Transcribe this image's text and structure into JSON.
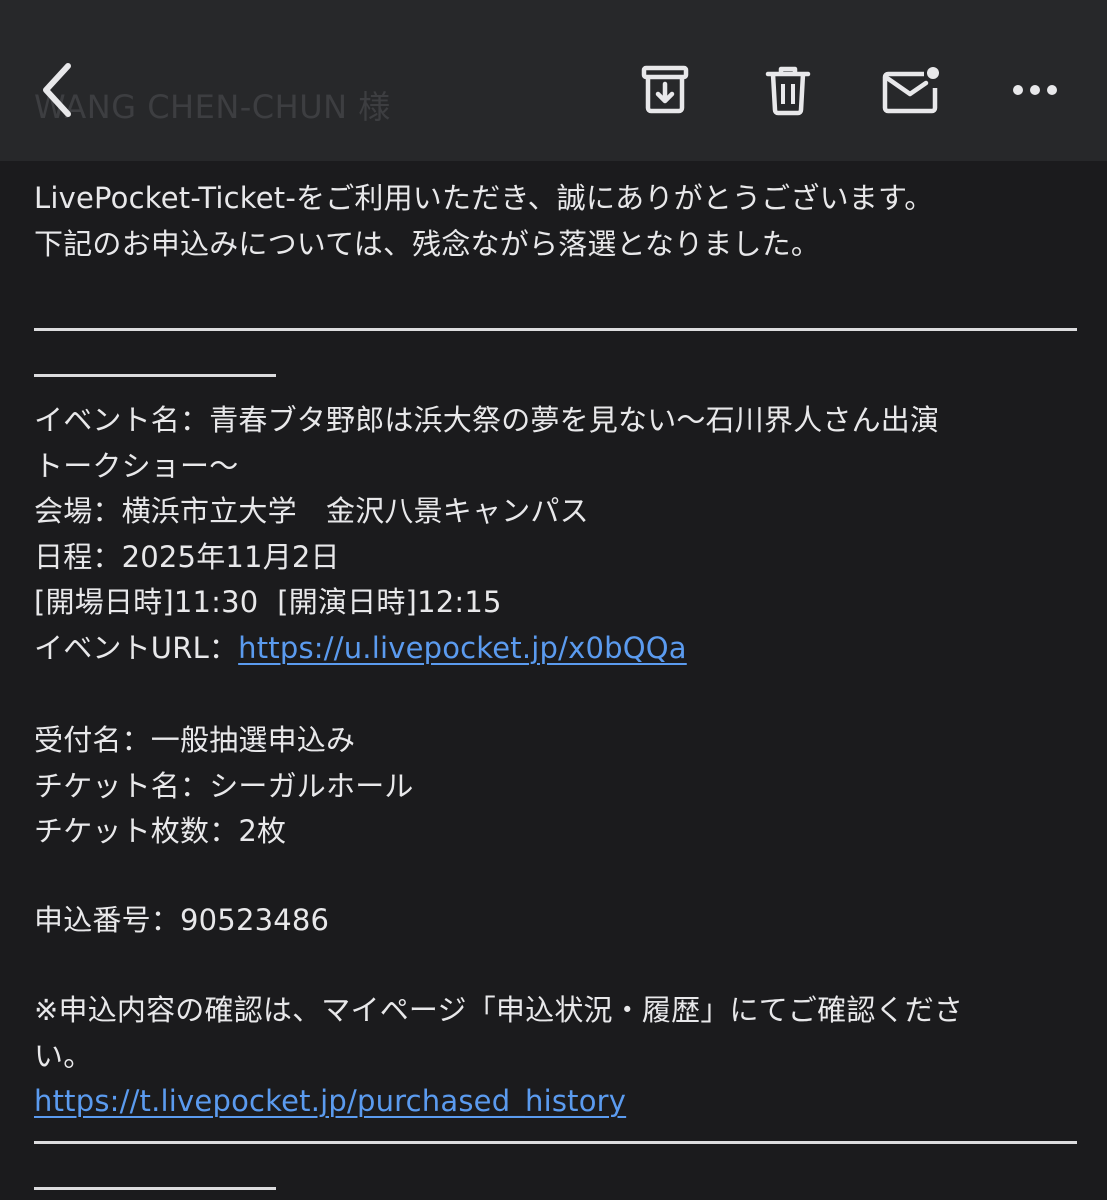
{
  "toolbar": {
    "recipient_ghost": "WANG CHEN-CHUN 様",
    "icons": [
      "back-arrow-icon",
      "archive-icon",
      "trash-icon",
      "mark-unread-icon",
      "more-icon"
    ]
  },
  "body": {
    "intro_1": "LivePocket-Ticket-をご利用いただき、誠にありがとうございます。",
    "intro_2": "下記のお申込みについては、残念ながら落選となりました。",
    "event_name_1": "イベント名：青春ブタ野郎は浜大祭の夢を見ない〜石川界人さん出演",
    "event_name_2": "トークショー〜",
    "venue": "会場：横浜市立大学　金沢八景キャンパス",
    "date": "日程：2025年11月2日",
    "times": "[開場日時]11:30  [開演日時]12:15",
    "event_url_label": "イベントURL：",
    "event_url": "https://u.livepocket.jp/x0bQQa",
    "reception_name": "受付名：一般抽選申込み",
    "ticket_name": "チケット名：シーガルホール",
    "ticket_count": "チケット枚数：2枚",
    "application_number": "申込番号：90523486",
    "note_1": "※申込内容の確認は、マイページ「申込状況・履歴」にてご確認くださ",
    "note_2": "い。",
    "history_url": "https://t.livepocket.jp/purchased_history"
  },
  "colors": {
    "background": "#1b1b1d",
    "toolbar": "#27282a",
    "text": "#e6e6e8",
    "link": "#5b9bef",
    "icon": "#e8e8ea"
  }
}
